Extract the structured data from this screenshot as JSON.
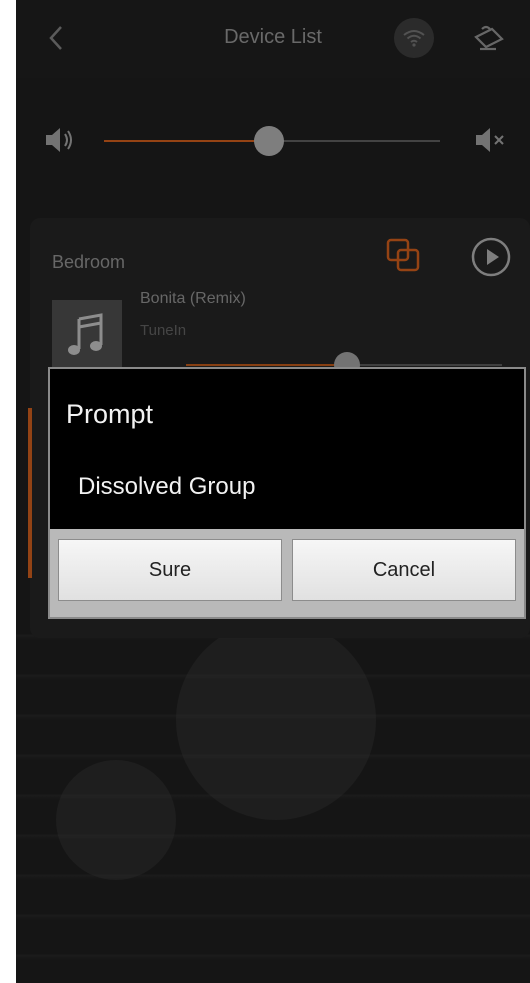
{
  "header": {
    "title": "Device List",
    "back_icon": "chevron-left-icon",
    "wifi_icon": "wifi-icon",
    "edit_icon": "edit-icon"
  },
  "master_volume": {
    "level": 0.49,
    "speaker_icon": "speaker-icon",
    "mute_icon": "mute-icon"
  },
  "room": {
    "name": "Bedroom",
    "group_icon": "group-icon",
    "play_icon": "play-icon",
    "track": {
      "title": "Bonita (Remix)",
      "source": "TuneIn"
    },
    "volume_level": 0.51
  },
  "dialog": {
    "title": "Prompt",
    "message": "Dissolved Group",
    "confirm_label": "Sure",
    "cancel_label": "Cancel"
  },
  "colors": {
    "accent": "#c75a1b",
    "background": "#1c1c1c"
  }
}
